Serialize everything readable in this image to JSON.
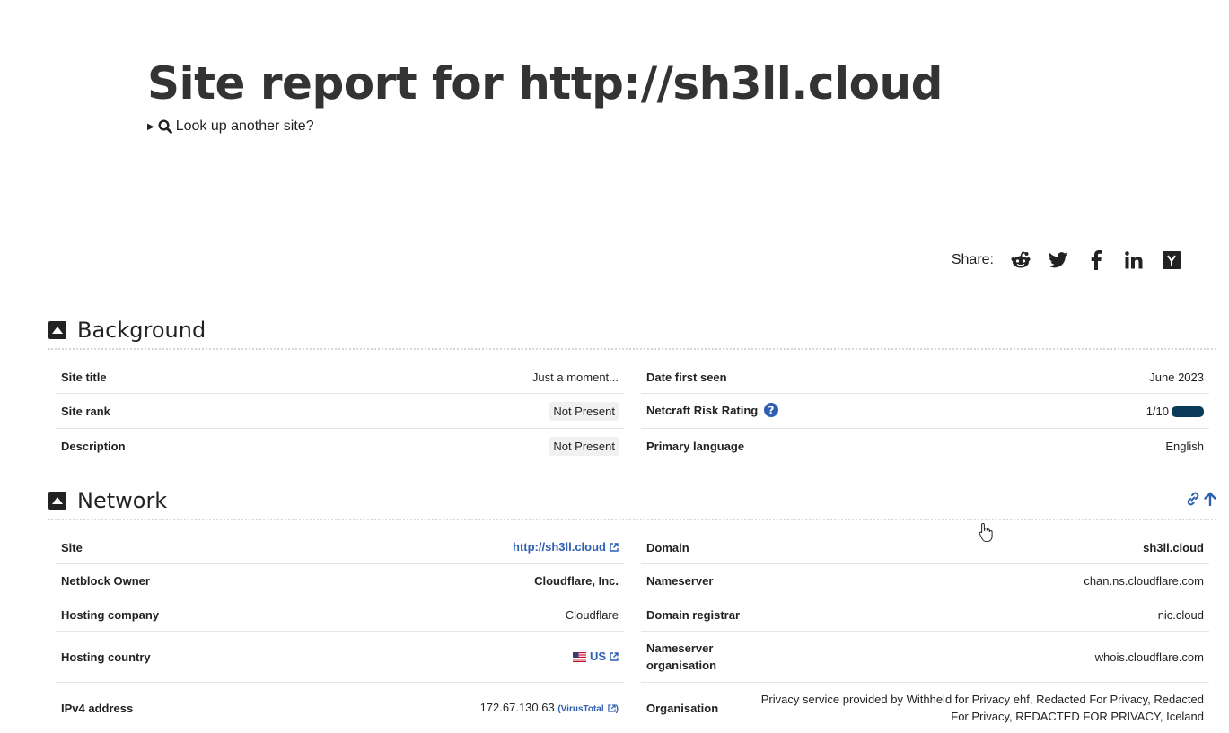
{
  "page_title": "Site report for http://sh3ll.cloud",
  "lookup": {
    "label": "Look up another site?"
  },
  "share": {
    "label": "Share:",
    "icons": [
      "reddit-icon",
      "twitter-icon",
      "facebook-icon",
      "linkedin-icon",
      "hackernews-icon"
    ]
  },
  "colors": {
    "link": "#2d5fb3",
    "risk_bar": "#0a3c5a",
    "heading": "#222222"
  },
  "background": {
    "title": "Background",
    "left": [
      {
        "key": "Site title",
        "value": "Just a moment..."
      },
      {
        "key": "Site rank",
        "value": "Not Present"
      },
      {
        "key": "Description",
        "value": "Not Present"
      }
    ],
    "right": [
      {
        "key": "Date first seen",
        "value": "June 2023"
      },
      {
        "key": "Netcraft Risk Rating",
        "value": "1/10"
      },
      {
        "key": "Primary language",
        "value": "English"
      }
    ]
  },
  "network": {
    "title": "Network",
    "left": [
      {
        "key": "Site",
        "value": "http://sh3ll.cloud"
      },
      {
        "key": "Netblock Owner",
        "value": "Cloudflare, Inc."
      },
      {
        "key": "Hosting company",
        "value": "Cloudflare"
      },
      {
        "key": "Hosting country",
        "value": "US"
      },
      {
        "key": "IPv4 address",
        "value": "172.67.130.63",
        "extra": "(VirusTotal"
      }
    ],
    "right": [
      {
        "key": "Domain",
        "value": "sh3ll.cloud"
      },
      {
        "key": "Nameserver",
        "value": "chan.ns.cloudflare.com"
      },
      {
        "key": "Domain registrar",
        "value": "nic.cloud"
      },
      {
        "key": "Nameserver organisation",
        "value": "whois.cloudflare.com"
      },
      {
        "key": "Organisation",
        "value": "Privacy service provided by Withheld for Privacy ehf, Redacted For Privacy, Redacted For Privacy, REDACTED FOR PRIVACY, Iceland"
      }
    ]
  }
}
